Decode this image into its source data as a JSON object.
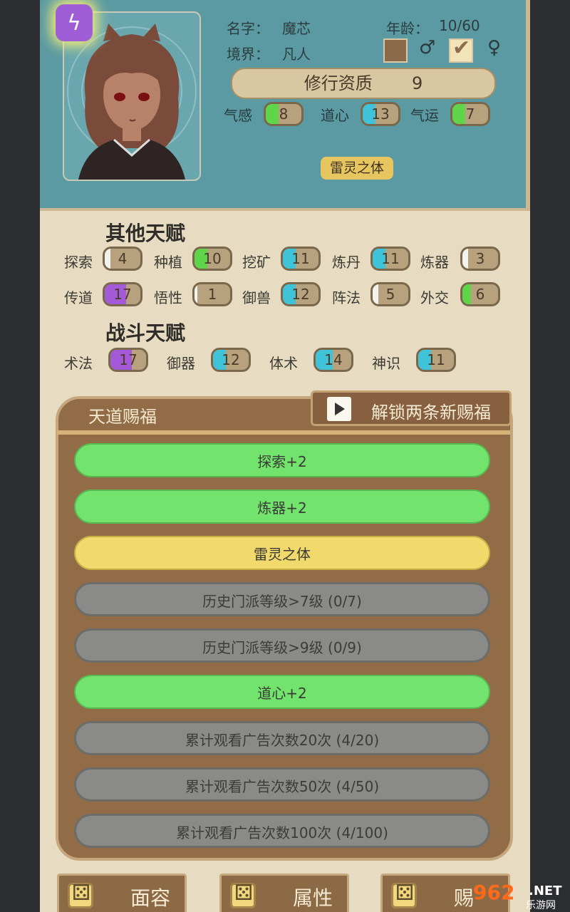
{
  "character": {
    "name_label": "名字：",
    "name": "魔芯",
    "realm_label": "境界：",
    "realm": "凡人",
    "age_label": "年龄：",
    "age": "10/60",
    "male_symbol": "♂",
    "female_symbol": "♀",
    "selected_gender": "female",
    "aptitude_label": "修行资质",
    "aptitude_value": "9",
    "trait": "雷灵之体",
    "lightning_icon": "lightning-icon"
  },
  "core_stats": [
    {
      "label": "气感",
      "value": "8",
      "color": "#5fd64a"
    },
    {
      "label": "道心",
      "value": "13",
      "color": "#3ec3d8"
    },
    {
      "label": "气运",
      "value": "7",
      "color": "#5fd64a"
    }
  ],
  "other_talents": {
    "title": "其他天赋",
    "items": [
      {
        "label": "探索",
        "value": "4",
        "color": "#f2f2ee"
      },
      {
        "label": "种植",
        "value": "10",
        "color": "#5fd64a"
      },
      {
        "label": "挖矿",
        "value": "11",
        "color": "#3ec3d8"
      },
      {
        "label": "炼丹",
        "value": "11",
        "color": "#3ec3d8"
      },
      {
        "label": "炼器",
        "value": "3",
        "color": "#f2f2ee"
      },
      {
        "label": "传道",
        "value": "17",
        "color": "#a45ad8"
      },
      {
        "label": "悟性",
        "value": "1",
        "color": "#f2f2ee"
      },
      {
        "label": "御兽",
        "value": "12",
        "color": "#3ec3d8"
      },
      {
        "label": "阵法",
        "value": "5",
        "color": "#f2f2ee"
      },
      {
        "label": "外交",
        "value": "6",
        "color": "#5fd64a"
      }
    ]
  },
  "combat_talents": {
    "title": "战斗天赋",
    "items": [
      {
        "label": "术法",
        "value": "17",
        "color": "#a45ad8"
      },
      {
        "label": "御器",
        "value": "12",
        "color": "#3ec3d8"
      },
      {
        "label": "体术",
        "value": "14",
        "color": "#3ec3d8"
      },
      {
        "label": "神识",
        "value": "11",
        "color": "#3ec3d8"
      }
    ]
  },
  "blessings": {
    "title": "天道赐福",
    "unlock_label": "解锁两条新赐福",
    "unlock_icon": "play-video-icon",
    "items": [
      {
        "label": "探索+2",
        "state": "green"
      },
      {
        "label": "炼器+2",
        "state": "green"
      },
      {
        "label": "雷灵之体",
        "state": "yellow"
      },
      {
        "label": "历史门派等级>7级 (0/7)",
        "state": "gray"
      },
      {
        "label": "历史门派等级>9级 (0/9)",
        "state": "gray"
      },
      {
        "label": "道心+2",
        "state": "green"
      },
      {
        "label": "累计观看广告次数20次 (4/20)",
        "state": "gray"
      },
      {
        "label": "累计观看广告次数50次 (4/50)",
        "state": "gray"
      },
      {
        "label": "累计观看广告次数100次 (4/100)",
        "state": "gray"
      }
    ]
  },
  "bottom_buttons": [
    {
      "label": "面容",
      "icon": "dice-icon"
    },
    {
      "label": "属性",
      "icon": "dice-icon"
    },
    {
      "label": "赐",
      "icon": "dice-icon"
    }
  ],
  "watermark": {
    "main": "962",
    "suffix": ".NET",
    "sub": "乐游网"
  }
}
